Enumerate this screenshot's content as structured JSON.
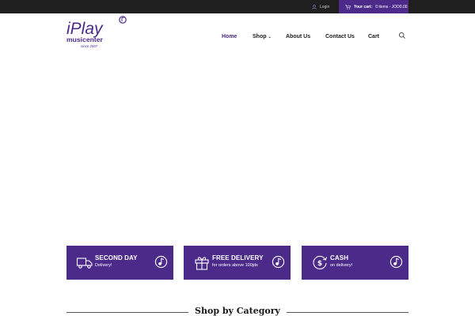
{
  "topbar": {
    "login_label": "Login",
    "cart_label": "Your cart:",
    "cart_value": "0 items - JOD0.00"
  },
  "logo": {
    "main_text": "iPlay",
    "sub_text": "musicenter",
    "tagline": "since 2007"
  },
  "nav": {
    "items": [
      {
        "label": "Home"
      },
      {
        "label": "Shop"
      },
      {
        "label": "About Us"
      },
      {
        "label": "Contact Us"
      },
      {
        "label": "Cart"
      }
    ],
    "active": "Home"
  },
  "features": [
    {
      "title": "SECOND DAY",
      "subtitle": "Delivery!",
      "icon": "truck-icon"
    },
    {
      "title": "FREE DELIVERY",
      "subtitle": "for orders above 100jds",
      "icon": "gift-icon"
    },
    {
      "title": "CASH",
      "subtitle": "on delivery!",
      "icon": "cash-icon"
    }
  ],
  "section": {
    "title": "Shop by Category"
  },
  "colors": {
    "brand": "#4b2a8a",
    "topbar": "#1f1f1f"
  }
}
